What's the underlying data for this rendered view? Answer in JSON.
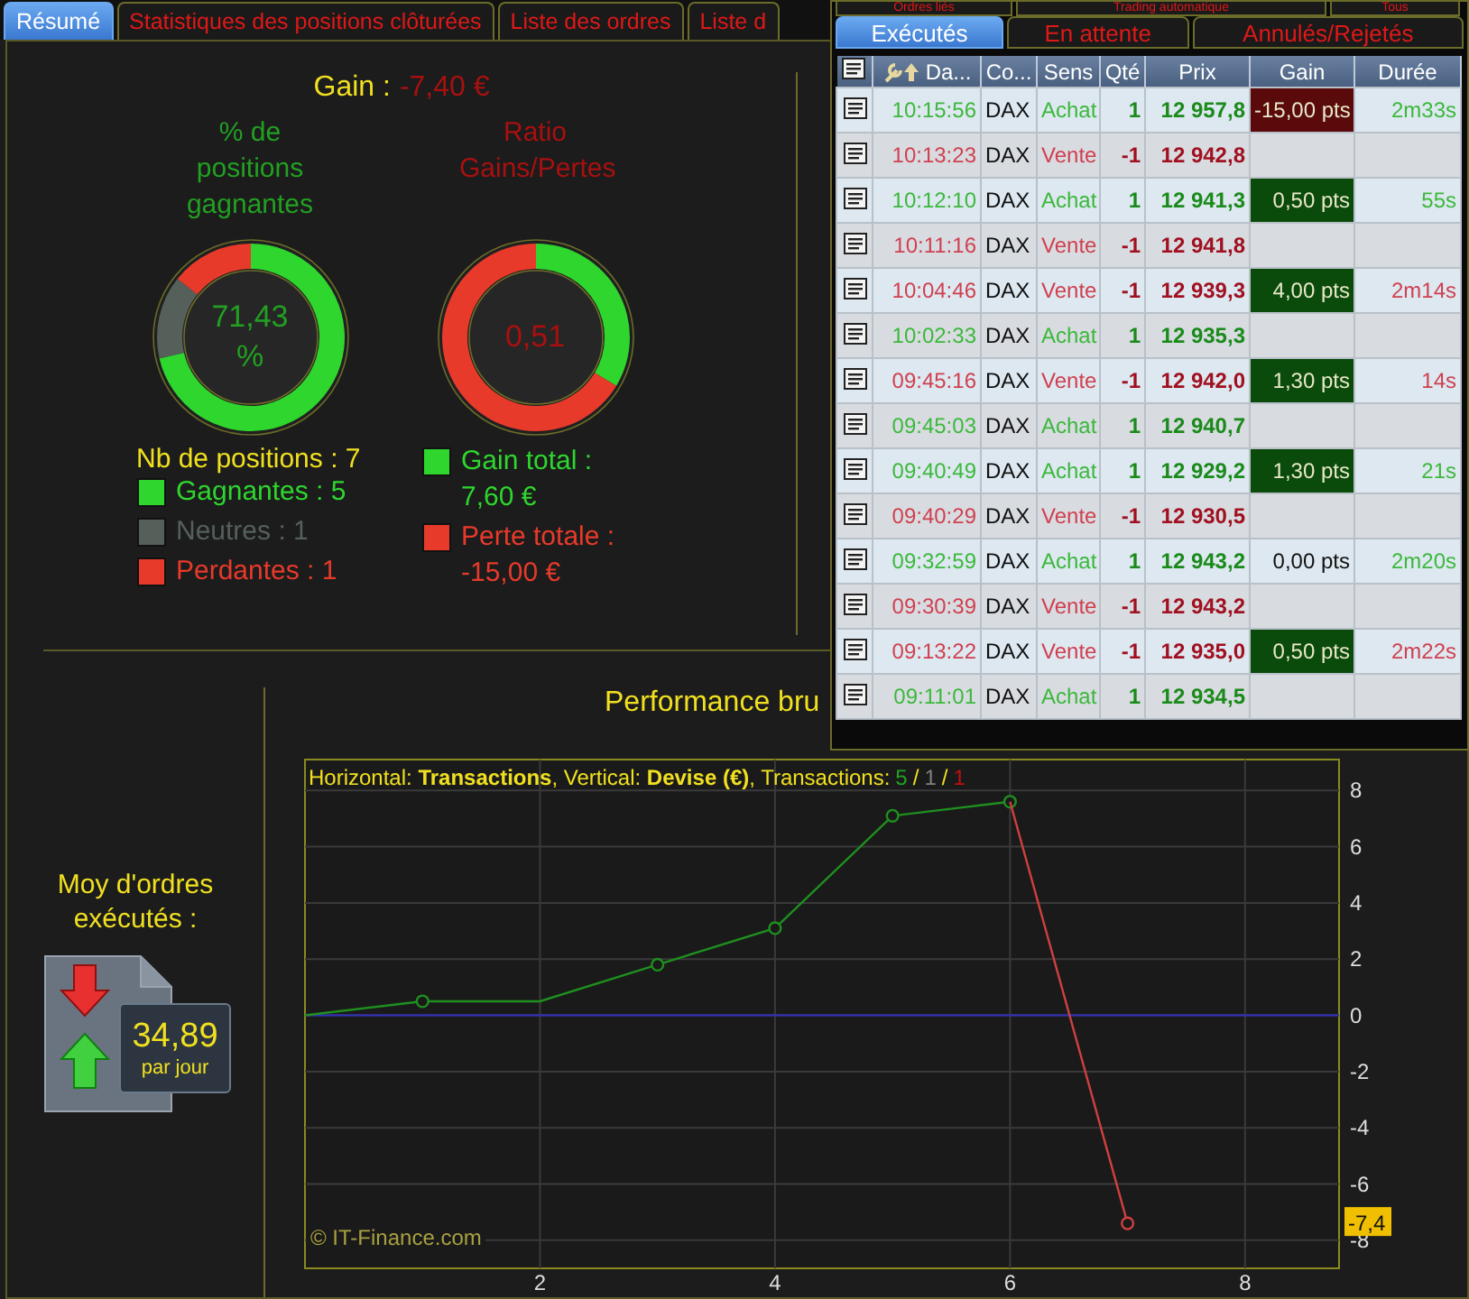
{
  "main_tabs": [
    {
      "label": "Résumé",
      "selected": true
    },
    {
      "label": "Statistiques des positions clôturées",
      "selected": false
    },
    {
      "label": "Liste des ordres",
      "selected": false
    },
    {
      "label": "Liste d",
      "selected": false
    }
  ],
  "summary": {
    "gain_label": "Gain :",
    "gain_value": "-7,40 €",
    "rings": [
      {
        "title": "% de positions gagnantes",
        "center": "71,43 %",
        "chart_data": {
          "type": "donut",
          "values": [
            71.43,
            14.29,
            14.28
          ]
        },
        "legend_heading": "Nb de positions : 7",
        "legend": [
          {
            "label": "Gagnantes : 5",
            "color": "#2ed62e"
          },
          {
            "label": "Neutres : 1",
            "color": "#55605a"
          },
          {
            "label": "Perdantes : 1",
            "color": "#e83a2a"
          }
        ]
      },
      {
        "title": "Ratio Gains/Pertes",
        "center": "0,51",
        "chart_data": {
          "type": "donut",
          "values": [
            33.63,
            66.37
          ]
        },
        "legend": [
          {
            "label": "Gain total : 7,60 €",
            "color": "#2ed62e"
          },
          {
            "label": "Perte totale : -15,00 €",
            "color": "#e83a2a"
          }
        ]
      }
    ]
  },
  "orders_stat": {
    "label": "Moy d'ordres exécutés :",
    "value": "34,89",
    "unit": "par jour"
  },
  "performance": {
    "title": "Performance bru",
    "caption": "Horizontal: **Transactions**, Vertical: **Devise (€)**, Transactions:",
    "counts": [
      {
        "value": "5",
        "color": "#22a022"
      },
      {
        "value": "1",
        "color": "#808080"
      },
      {
        "value": "1",
        "color": "#c01010"
      }
    ],
    "separator": "/",
    "credit": "© IT-Finance.com",
    "chart_data": {
      "type": "line",
      "x": [
        0,
        1,
        2,
        3,
        4,
        5,
        6,
        7
      ],
      "series": [
        {
          "color": "#1f8f1f",
          "values": [
            0,
            0.5,
            0.5,
            1.8,
            3.1,
            7.1,
            7.6,
            null
          ]
        },
        {
          "color": "#d04040",
          "values": [
            null,
            null,
            null,
            null,
            null,
            null,
            7.6,
            -7.4
          ]
        }
      ],
      "xlim": [
        0,
        8.8
      ],
      "ylim": [
        -9,
        9.1
      ],
      "xticks": [
        2,
        4,
        6,
        8
      ],
      "yticks": [
        -8,
        -6,
        -4,
        -2,
        0,
        2,
        4,
        6,
        8
      ],
      "grid": true,
      "ref_lines": [
        {
          "axis": "y",
          "value": 0,
          "color": "#3030c0"
        }
      ],
      "annotations": [
        {
          "y": -7.4,
          "text": "-7,4"
        }
      ]
    }
  },
  "orders_panel": {
    "top_tabs": [
      {
        "label": "Ordres liés",
        "selected": false
      },
      {
        "label": "Trading automatique",
        "selected": false
      },
      {
        "label": "Tous",
        "selected": false
      }
    ],
    "tabs": [
      {
        "label": "Exécutés",
        "selected": true
      },
      {
        "label": "En attente",
        "selected": false
      },
      {
        "label": "Annulés/Rejetés",
        "selected": false
      }
    ],
    "columns": [
      "Da...",
      "Co...",
      "Sens",
      "Qté",
      "Prix",
      "Gain",
      "Durée"
    ],
    "rows": [
      {
        "kind": "buy",
        "time": "10:15:56",
        "code": "DAX",
        "side": "Achat",
        "qty": "1",
        "price": "12 957,8",
        "gain": "-15,00 pts",
        "color": "#5a0a0a",
        "duration": "2m33s"
      },
      {
        "kind": "sell",
        "time": "10:13:23",
        "code": "DAX",
        "side": "Vente",
        "qty": "-1",
        "price": "12 942,8"
      },
      {
        "kind": "buy",
        "time": "10:12:10",
        "code": "DAX",
        "side": "Achat",
        "qty": "1",
        "price": "12 941,3",
        "gain": "0,50 pts",
        "color": "#0a4a0a",
        "duration": "55s"
      },
      {
        "kind": "sell",
        "time": "10:11:16",
        "code": "DAX",
        "side": "Vente",
        "qty": "-1",
        "price": "12 941,8"
      },
      {
        "kind": "sell",
        "time": "10:04:46",
        "code": "DAX",
        "side": "Vente",
        "qty": "-1",
        "price": "12 939,3",
        "gain": "4,00 pts",
        "color": "#0a4a0a",
        "duration": "2m14s"
      },
      {
        "kind": "buy",
        "time": "10:02:33",
        "code": "DAX",
        "side": "Achat",
        "qty": "1",
        "price": "12 935,3"
      },
      {
        "kind": "sell",
        "time": "09:45:16",
        "code": "DAX",
        "side": "Vente",
        "qty": "-1",
        "price": "12 942,0",
        "gain": "1,30 pts",
        "color": "#0a4a0a",
        "duration": "14s"
      },
      {
        "kind": "buy",
        "time": "09:45:03",
        "code": "DAX",
        "side": "Achat",
        "qty": "1",
        "price": "12 940,7"
      },
      {
        "kind": "buy",
        "time": "09:40:49",
        "code": "DAX",
        "side": "Achat",
        "qty": "1",
        "price": "12 929,2",
        "gain": "1,30 pts",
        "color": "#0a4a0a",
        "duration": "21s"
      },
      {
        "kind": "sell",
        "time": "09:40:29",
        "code": "DAX",
        "side": "Vente",
        "qty": "-1",
        "price": "12 930,5"
      },
      {
        "kind": "buy",
        "time": "09:32:59",
        "code": "DAX",
        "side": "Achat",
        "qty": "1",
        "price": "12 943,2",
        "gain": "0,00 pts",
        "duration": "2m20s"
      },
      {
        "kind": "sell",
        "time": "09:30:39",
        "code": "DAX",
        "side": "Vente",
        "qty": "-1",
        "price": "12 943,2"
      },
      {
        "kind": "sell",
        "time": "09:13:22",
        "code": "DAX",
        "side": "Vente",
        "qty": "-1",
        "price": "12 935,0",
        "gain": "0,50 pts",
        "color": "#0a4a0a",
        "duration": "2m22s"
      },
      {
        "kind": "buy",
        "time": "09:11:01",
        "code": "DAX",
        "side": "Achat",
        "qty": "1",
        "price": "12 934,5"
      }
    ]
  }
}
